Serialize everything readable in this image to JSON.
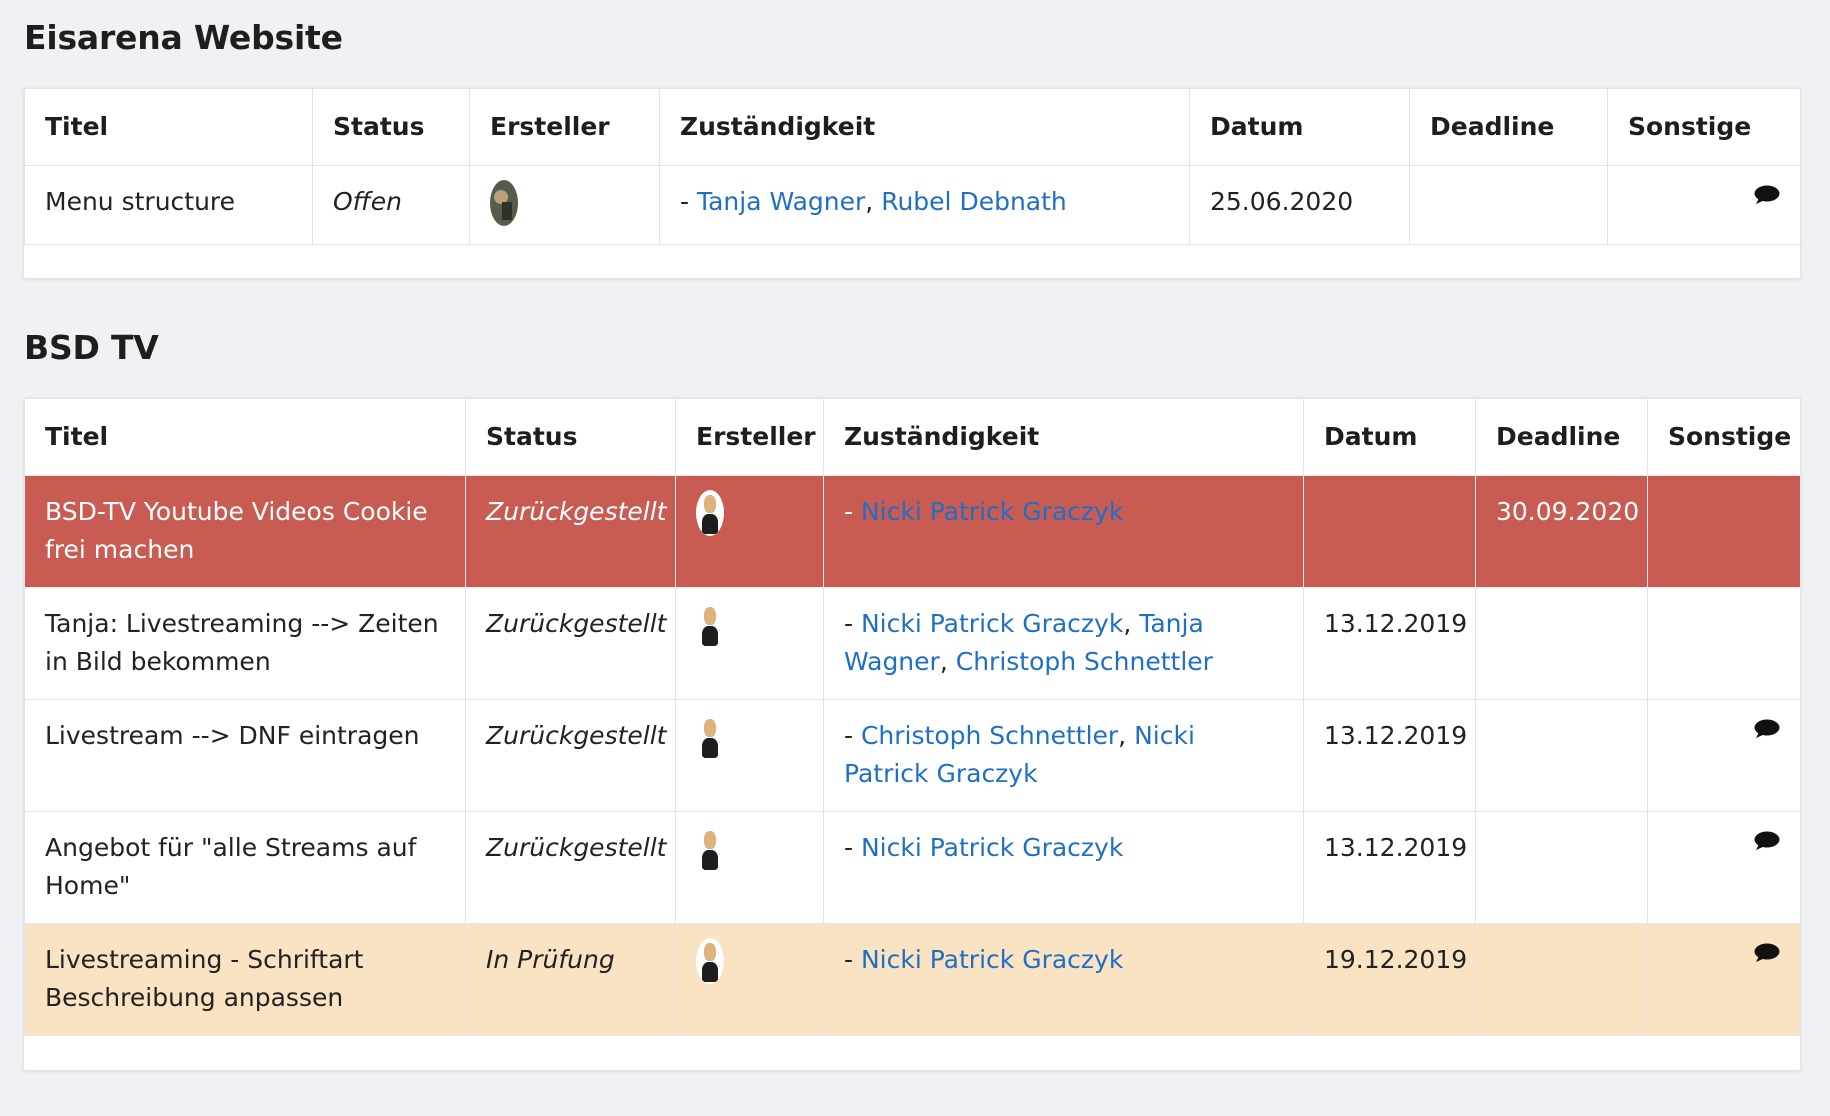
{
  "sections": [
    {
      "title": "Eisarena Website",
      "headers": [
        "Titel",
        "Status",
        "Ersteller",
        "Zuständigkeit",
        "Datum",
        "Deadline",
        "Sonstige"
      ],
      "rows": [
        {
          "title": "Menu structure",
          "status": "Offen",
          "creator_icon": "avatar-photo",
          "assignees": [
            "Tanja Wagner",
            "Rubel Debnath"
          ],
          "date": "25.06.2020",
          "deadline": "",
          "comment": true
        }
      ]
    },
    {
      "title": "BSD TV",
      "headers": [
        "Titel",
        "Status",
        "Ersteller",
        "Zuständigkeit",
        "Datum",
        "Deadline",
        "Sonstige"
      ],
      "rows": [
        {
          "title": "BSD-TV Youtube Videos Cookie frei machen",
          "status": "Zurückgestellt",
          "creator_icon": "avatar-photo",
          "assignees": [
            "Nicki Patrick Graczyk"
          ],
          "date": "",
          "deadline": "30.09.2020",
          "comment": false,
          "highlight": "#c85c53"
        },
        {
          "title": "Tanja: Livestreaming --> Zeiten in Bild bekommen",
          "status": "Zurückgestellt",
          "creator_icon": "avatar-photo",
          "assignees": [
            "Nicki Patrick Graczyk",
            "Tanja Wagner",
            "Christoph Schnettler"
          ],
          "date": "13.12.2019",
          "deadline": "",
          "comment": false
        },
        {
          "title": "Livestream --> DNF eintragen",
          "status": "Zurückgestellt",
          "creator_icon": "avatar-photo",
          "assignees": [
            "Christoph Schnettler",
            "Nicki Patrick Graczyk"
          ],
          "date": "13.12.2019",
          "deadline": "",
          "comment": true
        },
        {
          "title": "Angebot für \"alle Streams auf Home\"",
          "status": "Zurückgestellt",
          "creator_icon": "avatar-photo",
          "assignees": [
            "Nicki Patrick Graczyk"
          ],
          "date": "13.12.2019",
          "deadline": "",
          "comment": true
        },
        {
          "title": "Livestreaming - Schriftart Beschreibung anpassen",
          "status": "In Prüfung",
          "creator_icon": "avatar-photo",
          "assignees": [
            "Nicki Patrick Graczyk"
          ],
          "date": "19.12.2019",
          "deadline": "",
          "comment": true,
          "highlight": "#f9e3c2"
        }
      ]
    }
  ],
  "colors": {
    "link": "#1f6fc5",
    "background": "#f0f1f4",
    "row_red": "#c85c53",
    "row_beige": "#f9e3c2"
  },
  "icons": {
    "comment": "speech-bubble-icon",
    "creator": "avatar-photo"
  }
}
